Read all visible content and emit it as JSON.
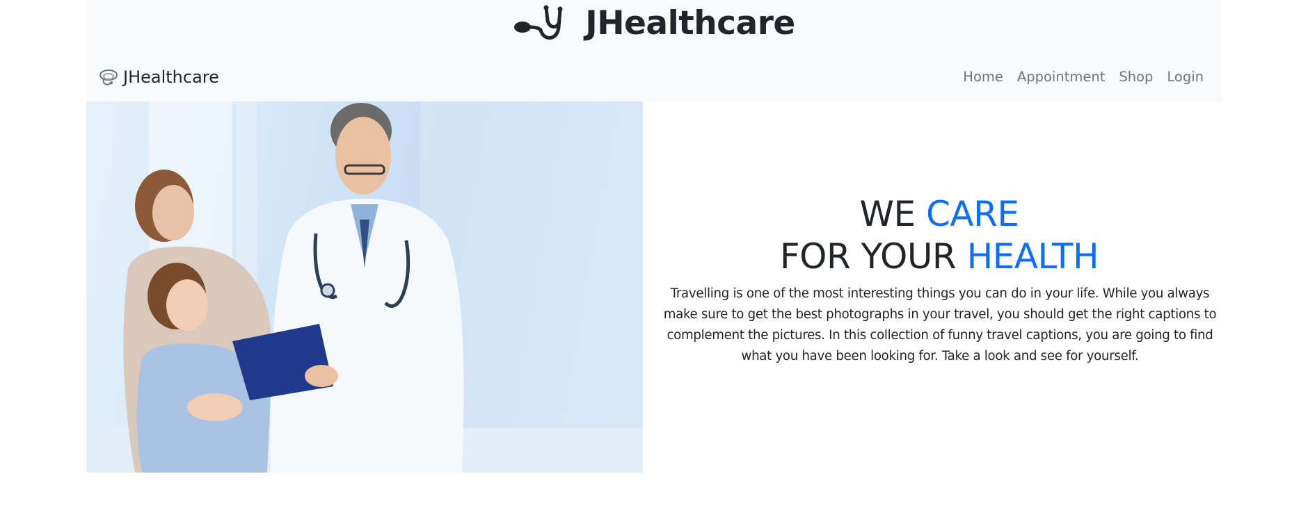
{
  "header": {
    "site_title": "JHealthcare",
    "logo_icon": "stethoscope-icon"
  },
  "navbar": {
    "brand_label": "JHealthcare",
    "brand_icon": "stethoscope-icon",
    "links": [
      {
        "label": "Home"
      },
      {
        "label": "Appointment"
      },
      {
        "label": "Shop"
      },
      {
        "label": "Login"
      }
    ]
  },
  "hero": {
    "image_alt": "doctor-with-family-photo",
    "headline_line1_a": "WE ",
    "headline_line1_b": "CARE",
    "headline_line2_a": "FOR YOUR ",
    "headline_line2_b": "HEALTH",
    "description": "Travelling is one of the most interesting things you can do in your life. While you always make sure to get the best photographs in your travel, you should get the right captions to complement the pictures. In this collection of funny travel captions, you are going to find what you have been looking for. Take a look and see for yourself."
  },
  "colors": {
    "accent": "#0d6efd",
    "header_bg": "#f8f9fa",
    "nav_link": "#6c757d",
    "text": "#212529"
  }
}
